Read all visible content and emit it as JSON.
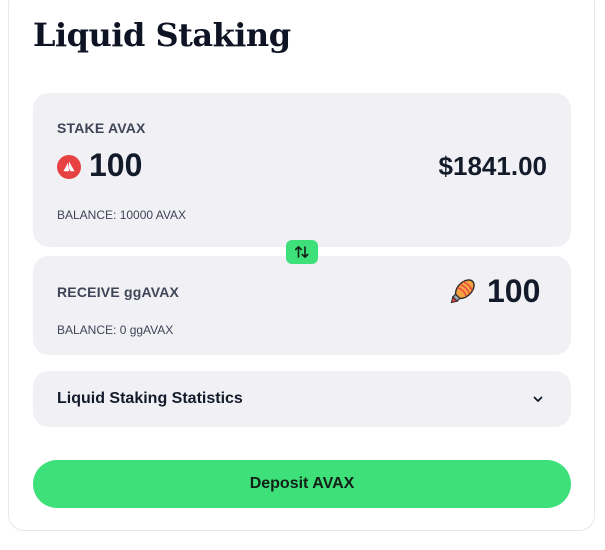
{
  "header": {
    "title": "Liquid Staking"
  },
  "stake": {
    "label": "STAKE AVAX",
    "amount": "100",
    "usd_value": "$1841.00",
    "balance": "BALANCE: 10000 AVAX",
    "token_icon": "avax-icon"
  },
  "swap": {
    "icon": "swap-arrows-icon",
    "color": "#3ee07a"
  },
  "receive": {
    "label": "RECEIVE ggAVAX",
    "amount": "100",
    "balance": "BALANCE: 0 ggAVAX",
    "token_icon": "ggavax-rocket-icon"
  },
  "stats": {
    "label": "Liquid Staking Statistics",
    "icon": "chevron-down-icon"
  },
  "actions": {
    "deposit_label": "Deposit AVAX"
  },
  "colors": {
    "accent": "#3ee07a",
    "avax_red": "#e84142",
    "panel_bg": "#f1f1f5"
  }
}
